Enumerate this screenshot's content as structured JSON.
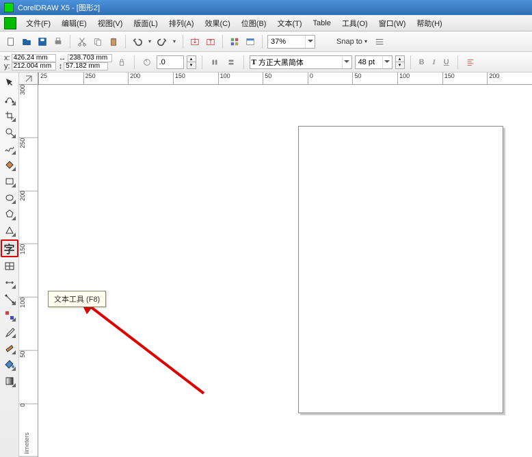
{
  "title": "CorelDRAW X5 - [图形2]",
  "menu": [
    "文件(F)",
    "编辑(E)",
    "视图(V)",
    "版面(L)",
    "排列(A)",
    "效果(C)",
    "位图(B)",
    "文本(T)",
    "Table",
    "工具(O)",
    "窗口(W)",
    "帮助(H)"
  ],
  "coords": {
    "x_label": "x:",
    "x": "426.24 mm",
    "y_label": "y:",
    "y": "212.004 mm",
    "w": "238.703 mm",
    "h": "57.182 mm"
  },
  "rotation": ".0",
  "font_name": "方正大黑简体",
  "font_size": "48 pt",
  "zoom": "37%",
  "snap_label": "Snap to",
  "ruler_h": [
    "25",
    "250",
    "200",
    "150",
    "100",
    "50",
    "0",
    "50",
    "100",
    "150",
    "200"
  ],
  "ruler_v": [
    "300",
    "250",
    "200",
    "150",
    "100",
    "50",
    "0"
  ],
  "tooltip": "文本工具 (F8)",
  "text_tool_glyph": "字",
  "millimeters_label": "limeters",
  "biu": {
    "b": "B",
    "i": "I",
    "u": "U"
  }
}
